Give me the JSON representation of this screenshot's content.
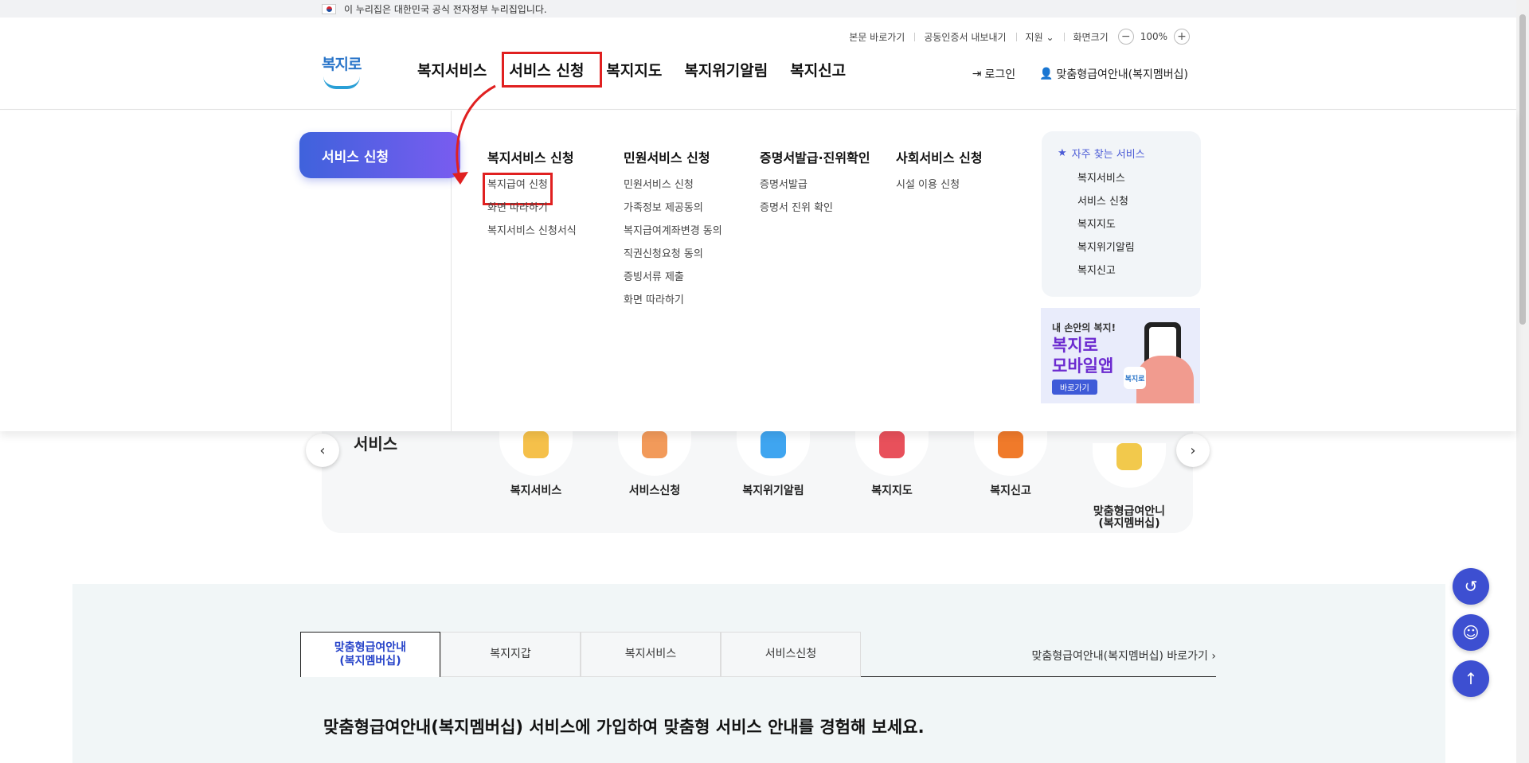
{
  "gov_strip": {
    "text": "이 누리집은 대한민국 공식 전자정부 누리집입니다."
  },
  "util": {
    "skip": "본문 바로가기",
    "cert": "공동인증서 내보내기",
    "support": "지원",
    "zoom_label": "화면크기",
    "zoom_minus": "−",
    "zoom_value": "100%",
    "zoom_plus": "+"
  },
  "logo": {
    "text": "복지로"
  },
  "gnb": [
    "복지서비스",
    "서비스 신청",
    "복지지도",
    "복지위기알림",
    "복지신고"
  ],
  "header_right": {
    "login": "로그인",
    "membership": "맞춤형급여안내(복지멤버십)"
  },
  "mega": {
    "tab": "서비스 신청",
    "columns": [
      {
        "title": "복지서비스 신청",
        "links": [
          "복지급여 신청",
          "화면 따라하기",
          "복지서비스 신청서식"
        ]
      },
      {
        "title": "민원서비스 신청",
        "links": [
          "민원서비스 신청",
          "가족정보 제공동의",
          "복지급여계좌변경 동의",
          "직권신청요청 동의",
          "증빙서류 제출",
          "화면 따라하기"
        ]
      },
      {
        "title": "증명서발급·진위확인",
        "links": [
          "증명서발급",
          "증명서 진위 확인"
        ]
      },
      {
        "title": "사회서비스 신청",
        "links": [
          "시설 이용 신청"
        ]
      }
    ],
    "favorites": {
      "title": "자주 찾는 서비스",
      "items": [
        "복지서비스",
        "서비스 신청",
        "복지지도",
        "복지위기알림",
        "복지신고"
      ]
    },
    "banner": {
      "line1": "내 손안의 복지!",
      "line2": "복지로",
      "line3": "모바일앱",
      "button": "바로가기",
      "app_label": "복지로"
    }
  },
  "quick": {
    "title": "서비스",
    "items": [
      {
        "label": "복지서비스",
        "color": "#f5c04a"
      },
      {
        "label": "서비스신청",
        "color": "#f29a5a"
      },
      {
        "label": "복지위기알림",
        "color": "#3fa5f0"
      },
      {
        "label": "복지지도",
        "color": "#e8505b"
      },
      {
        "label": "복지신고",
        "color": "#f07a2a"
      },
      {
        "label": "맞춤형급여안니\n(복지멤버십)",
        "color": "#f2c94c"
      }
    ],
    "prev": "‹",
    "next": "›"
  },
  "member": {
    "tabs": [
      "맞춤형급여안내\n(복지멤버십)",
      "복지지갑",
      "복지서비스",
      "서비스신청"
    ],
    "link": "맞춤형급여안내(복지멤버십) 바로가기 ›",
    "headline": "맞춤형급여안내(복지멤버십) 서비스에 가입하여 맞춤형 서비스 안내를 경험해 보세요."
  },
  "float": {
    "recent": "↺",
    "top": "↑"
  },
  "colors": {
    "accent": "#3d4fd1",
    "highlight": "#e02020",
    "brand": "#2a75c9"
  }
}
